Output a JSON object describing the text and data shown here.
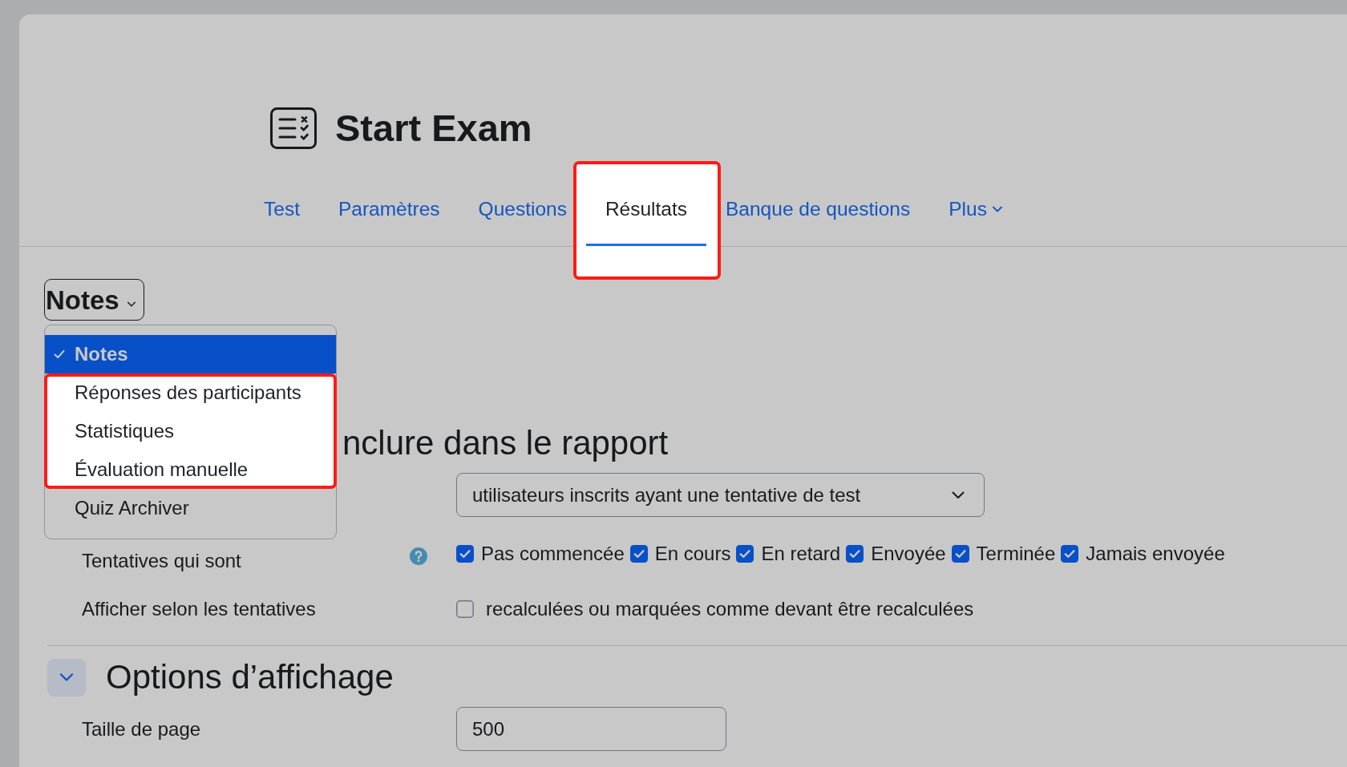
{
  "header": {
    "title": "Start Exam"
  },
  "tabs": [
    {
      "label": "Test",
      "kind": "link",
      "selected": false,
      "highlighted": false
    },
    {
      "label": "Paramètres",
      "kind": "link",
      "selected": false,
      "highlighted": false
    },
    {
      "label": "Questions",
      "kind": "link",
      "selected": false,
      "highlighted": false
    },
    {
      "label": "Résultats",
      "kind": "link",
      "selected": true,
      "highlighted": true
    },
    {
      "label": "Banque de questions",
      "kind": "link",
      "selected": false,
      "highlighted": false
    },
    {
      "label": "Plus",
      "kind": "dropdown",
      "selected": false,
      "highlighted": false
    }
  ],
  "report_select": {
    "value": "Notes",
    "expanded": true,
    "options": [
      {
        "label": "Notes",
        "selected": true,
        "highlighted": false
      },
      {
        "label": "Réponses des participants",
        "selected": false,
        "highlighted": true
      },
      {
        "label": "Statistiques",
        "selected": false,
        "highlighted": true
      },
      {
        "label": "Évaluation manuelle",
        "selected": false,
        "highlighted": true
      },
      {
        "label": "Quiz Archiver",
        "selected": false,
        "highlighted": false
      }
    ]
  },
  "sections": [
    {
      "title": "nclure dans le rapport",
      "fields": [
        {
          "kind": "select",
          "value": "utilisateurs inscrits ayant une tentative de test"
        },
        {
          "kind": "checkbox_group",
          "label": "Tentatives qui sont",
          "help": true,
          "options": [
            {
              "label": "Pas commencée",
              "checked": true
            },
            {
              "label": "En cours",
              "checked": true
            },
            {
              "label": "En retard",
              "checked": true
            },
            {
              "label": "Envoyée",
              "checked": true
            },
            {
              "label": "Terminée",
              "checked": true
            },
            {
              "label": "Jamais envoyée",
              "checked": true
            }
          ]
        },
        {
          "kind": "checkbox",
          "label": "Afficher selon les tentatives",
          "help": false,
          "options": [
            {
              "label": "recalculées ou marquées comme devant être recalculées",
              "checked": false
            }
          ]
        }
      ]
    },
    {
      "title": "Options d’affichage",
      "toggle": {
        "expanded": true
      },
      "fields": [
        {
          "kind": "text",
          "label": "Taille de page",
          "help": false,
          "value": "500"
        }
      ]
    }
  ]
}
